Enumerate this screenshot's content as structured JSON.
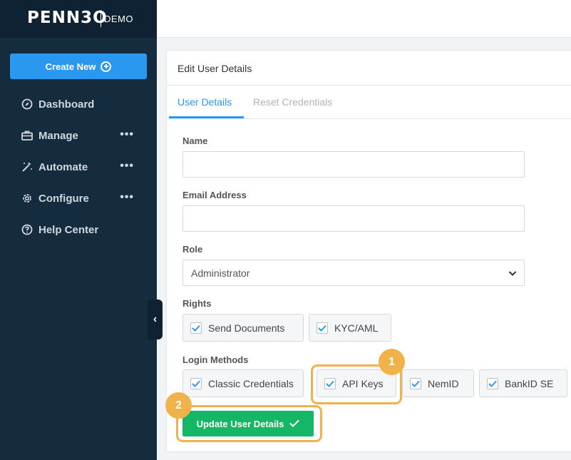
{
  "brand": {
    "logo_text": "PENN3O",
    "logo_tag": "DEMO"
  },
  "sidebar": {
    "create_new_label": "Create New",
    "items": [
      {
        "label": "Dashboard",
        "icon": "compass-icon",
        "has_more": false
      },
      {
        "label": "Manage",
        "icon": "briefcase-icon",
        "has_more": true
      },
      {
        "label": "Automate",
        "icon": "magic-wand-icon",
        "has_more": true
      },
      {
        "label": "Configure",
        "icon": "gear-icon",
        "has_more": true
      },
      {
        "label": "Help Center",
        "icon": "question-circle-icon",
        "has_more": false
      }
    ],
    "more_glyph": "•••",
    "collapse_glyph": "‹"
  },
  "card": {
    "title": "Edit User Details",
    "tabs": [
      {
        "label": "User Details",
        "active": true
      },
      {
        "label": "Reset Credentials",
        "active": false
      }
    ]
  },
  "form": {
    "name_label": "Name",
    "name_value": "",
    "email_label": "Email Address",
    "email_value": "",
    "role_label": "Role",
    "role_value": "Administrator",
    "rights_label": "Rights",
    "rights": [
      {
        "label": "Send Documents",
        "checked": true
      },
      {
        "label": "KYC/AML",
        "checked": true
      }
    ],
    "login_methods_label": "Login Methods",
    "login_methods": [
      {
        "label": "Classic Credentials",
        "checked": true
      },
      {
        "label": "API Keys",
        "checked": true
      },
      {
        "label": "NemID",
        "checked": true
      },
      {
        "label": "BankID SE",
        "checked": true
      }
    ],
    "submit_label": "Update User Details"
  },
  "callouts": [
    {
      "number": "1",
      "target": "API Keys"
    },
    {
      "number": "2",
      "target": "Update User Details"
    }
  ],
  "colors": {
    "sidebar_bg": "#152c3f",
    "accent_blue": "#2b98f0",
    "submit_green": "#14b765",
    "callout_orange": "#f2b24a"
  }
}
